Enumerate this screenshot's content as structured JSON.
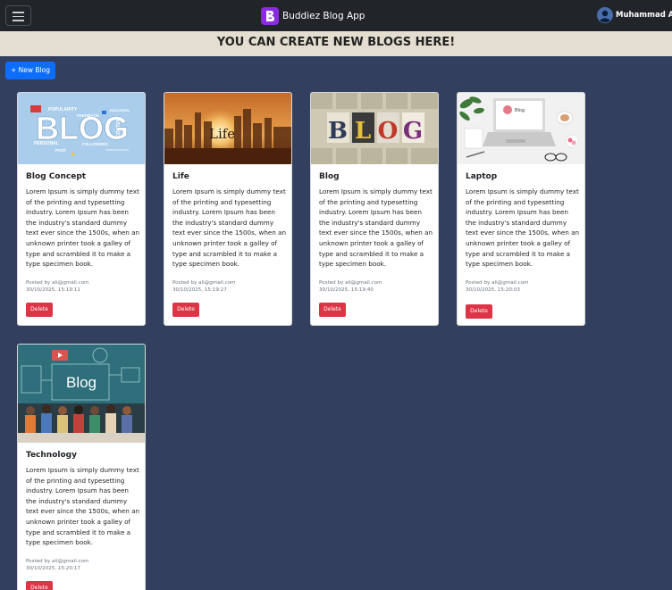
{
  "navbar": {
    "brand_name": "Buddiez Blog App",
    "user_name": "Muhammad Ali"
  },
  "banner": {
    "text": "YOU CAN CREATE NEW BLOGS HERE!"
  },
  "toolbar": {
    "new_blog_label": "+ New Blog"
  },
  "posts": [
    {
      "title": "Blog Concept",
      "body": "Lorem Ipsum is simply dummy text of the printing and typesetting industry. Lorem Ipsum has been the industry's standard dummy text ever since the 1500s, when an unknown printer took a galley of type and scrambled it to make a type specimen book.",
      "posted_by": "Posted by ali@gmail.com",
      "posted_at": "30/10/2025, 15:19:11",
      "delete_label": "Delete",
      "image": {
        "words": [
          "BLOG",
          "POPULARITY",
          "FEEDBACK",
          "DISCUSSION",
          "PERSONAL",
          "POST",
          "FOLLOWERS",
          "CONTENT",
          "COMMUNICATION"
        ]
      }
    },
    {
      "title": "Life",
      "body": "Lorem Ipsum is simply dummy text of the printing and typesetting industry. Lorem Ipsum has been the industry's standard dummy text ever since the 1500s, when an unknown printer took a galley of type and scrambled it to make a type specimen book.",
      "posted_by": "Posted by ali@gmail.com",
      "posted_at": "30/10/2025, 15:19:27",
      "delete_label": "Delete",
      "image": {
        "word": "Life"
      }
    },
    {
      "title": "Blog",
      "body": "Lorem Ipsum is simply dummy text of the printing and typesetting industry. Lorem Ipsum has been the industry's standard dummy text ever since the 1500s, when an unknown printer took a galley of type and scrambled it to make a type specimen book.",
      "posted_by": "Posted by ali@gmail.com",
      "posted_at": "30/10/2025, 15:19:40",
      "delete_label": "Delete",
      "image": {
        "letters": [
          "B",
          "L",
          "O",
          "G"
        ]
      }
    },
    {
      "title": "Laptop",
      "body": "Lorem Ipsum is simply dummy text of the printing and typesetting industry. Lorem Ipsum has been the industry's standard dummy text ever since the 1500s, when an unknown printer took a galley of type and scrambled it to make a type specimen book.",
      "posted_by": "Posted by ali@gmail.com",
      "posted_at": "30/10/2025, 15:20:03",
      "delete_label": "Delete",
      "image": {
        "screen_word": "Blog"
      }
    },
    {
      "title": "Technology",
      "body": "Lorem Ipsum is simply dummy text of the printing and typesetting industry. Lorem Ipsum has been the industry's standard dummy text ever since the 1500s, when an unknown printer took a galley of type and scrambled it to make a type specimen book.",
      "posted_by": "Posted by ali@gmail.com",
      "posted_at": "30/10/2025, 15:20:17",
      "delete_label": "Delete",
      "image": {
        "word": "Blog"
      }
    }
  ],
  "icons": {
    "menu": "hamburger-menu-icon",
    "brand": "blogger-logo-icon",
    "user": "user-avatar-icon"
  },
  "colors": {
    "page_background": "#333f5f",
    "navbar": "#212529",
    "banner": "#e4ded1",
    "primary": "#0d6efd",
    "danger": "#dc3545",
    "brand": "#8a2be2"
  }
}
